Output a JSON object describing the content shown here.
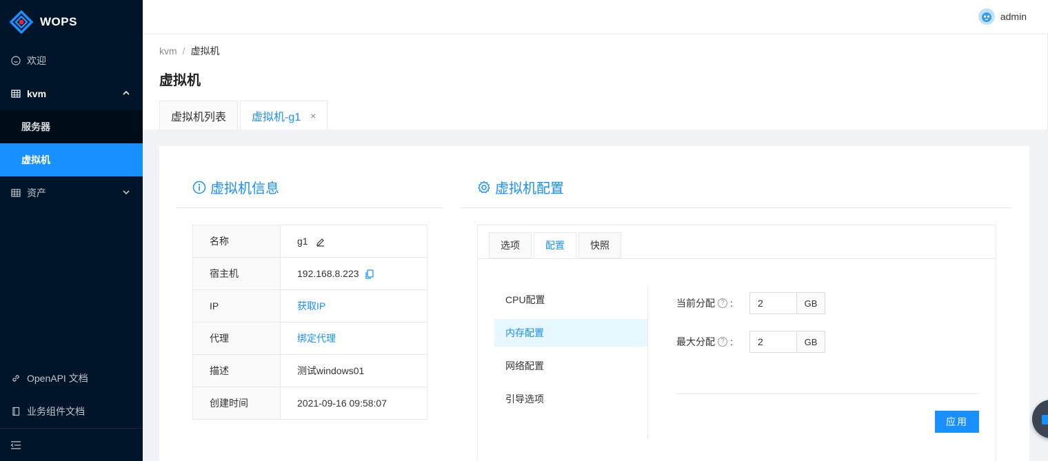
{
  "app": {
    "name": "WOPS"
  },
  "sidebar": {
    "items": [
      {
        "label": "欢迎",
        "icon": "smile-icon"
      },
      {
        "label": "kvm",
        "icon": "table-icon"
      },
      {
        "label": "资产",
        "icon": "table-icon"
      }
    ],
    "kvm_children": [
      {
        "label": "服务器"
      },
      {
        "label": "虚拟机"
      }
    ],
    "bottom": [
      {
        "label": "OpenAPI 文档",
        "icon": "link-icon"
      },
      {
        "label": "业务组件文档",
        "icon": "book-icon"
      }
    ]
  },
  "header": {
    "user": "admin"
  },
  "breadcrumb": {
    "root": "kvm",
    "sep": "/",
    "current": "虚拟机"
  },
  "page": {
    "title": "虚拟机",
    "tabs": [
      {
        "label": "虚拟机列表"
      },
      {
        "label": "虚拟机-g1",
        "close": "×"
      }
    ]
  },
  "info": {
    "title": "虚拟机信息",
    "rows": [
      {
        "key": "名称",
        "value": "g1"
      },
      {
        "key": "宿主机",
        "value": "192.168.8.223"
      },
      {
        "key": "IP",
        "value": "获取IP"
      },
      {
        "key": "代理",
        "value": "绑定代理"
      },
      {
        "key": "描述",
        "value": "测试windows01"
      },
      {
        "key": "创建时间",
        "value": "2021-09-16 09:58:07"
      }
    ]
  },
  "config": {
    "title": "虚拟机配置",
    "tabs": [
      {
        "label": "选项"
      },
      {
        "label": "配置"
      },
      {
        "label": "快照"
      }
    ],
    "menu": [
      {
        "label": "CPU配置"
      },
      {
        "label": "内存配置"
      },
      {
        "label": "网络配置"
      },
      {
        "label": "引导选项"
      }
    ],
    "form": {
      "current_label": "当前分配",
      "current_value": "2",
      "max_label": "最大分配",
      "max_value": "2",
      "unit": "GB",
      "colon": ":"
    },
    "apply_label": "应用"
  },
  "colors": {
    "primary": "#1890ff",
    "sider": "#001529"
  }
}
